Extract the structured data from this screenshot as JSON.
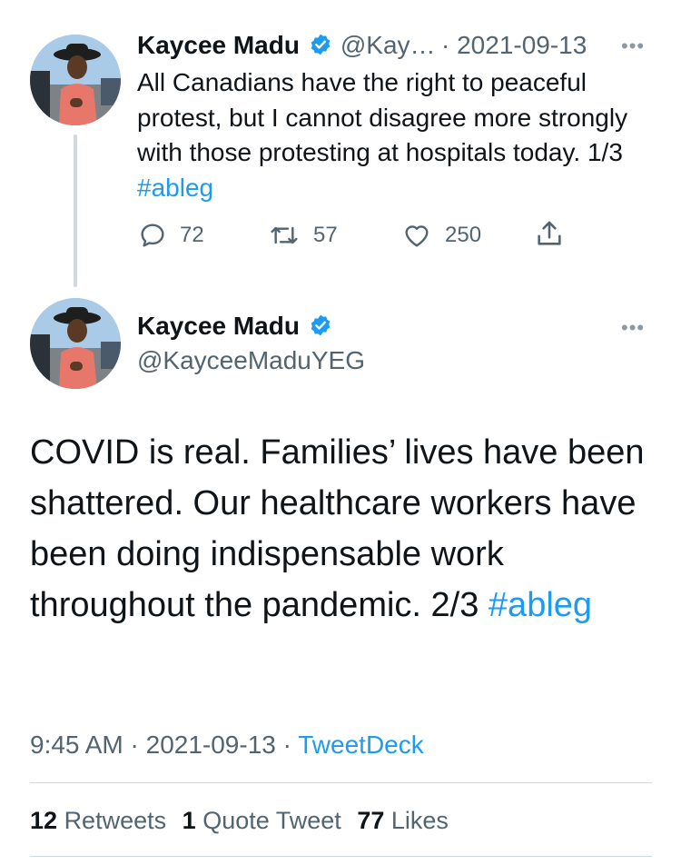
{
  "tweet1": {
    "author_name": "Kaycee Madu",
    "handle_truncated": "@Kay…",
    "date": "· 2021-09-13",
    "text": "All Canadians have the right to peaceful protest, but I cannot disagree more strongly with those protesting at hospitals today. 1/3 ",
    "hashtag": "#ableg",
    "replies": "72",
    "retweets": "57",
    "likes": "250"
  },
  "tweet2": {
    "author_name": "Kaycee Madu",
    "handle": "@KayceeMaduYEG",
    "text": "COVID is real. Families’ lives have been shattered. Our healthcare workers have been doing indispensable work throughout the pandemic. 2/3 ",
    "hashtag": "#ableg",
    "time": "9:45 AM",
    "sep1": " · ",
    "date": "2021-09-13",
    "sep2": " · ",
    "source": "TweetDeck",
    "retweets_count": "12",
    "retweets_label": "Retweets",
    "quotes_count": "1",
    "quotes_label": "Quote Tweet",
    "likes_count": "77",
    "likes_label": "Likes"
  },
  "more_glyph": "•••",
  "colors": {
    "link": "#1d9bf0",
    "muted": "#536471",
    "verified": "#1d9bf0",
    "divider": "#cfd9de"
  },
  "icons": [
    "verified-badge-icon",
    "reply-icon",
    "retweet-icon",
    "like-icon",
    "share-icon",
    "more-icon"
  ]
}
